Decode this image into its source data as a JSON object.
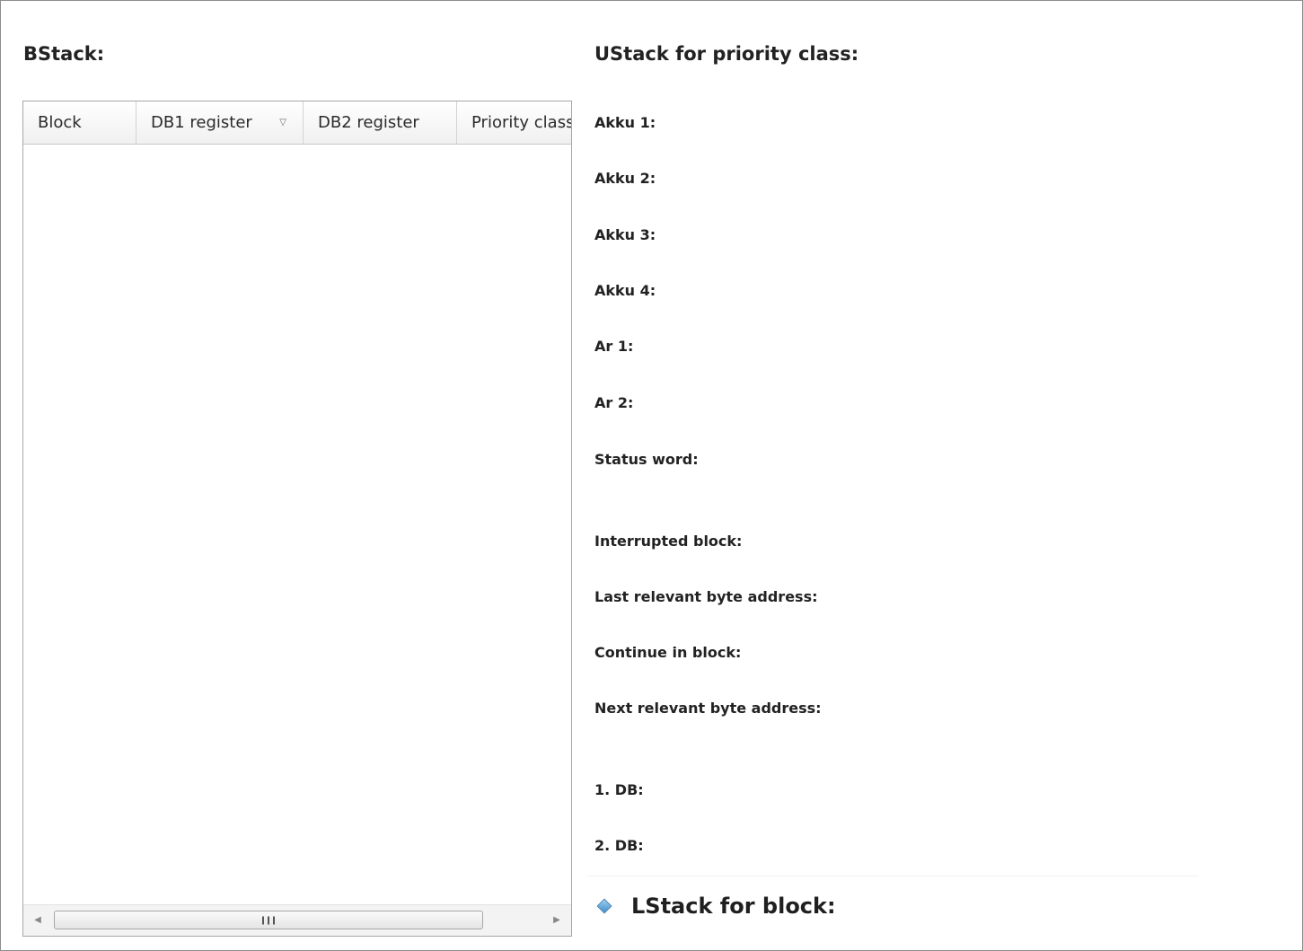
{
  "bstack": {
    "title": "BStack:",
    "columns": [
      "Block",
      "DB1 register",
      "DB2 register",
      "Priority class"
    ],
    "rows": []
  },
  "ustack": {
    "title": "UStack for priority class:",
    "fields": {
      "akku1": "Akku 1:",
      "akku2": "Akku 2:",
      "akku3": "Akku 3:",
      "akku4": "Akku 4:",
      "ar1": "Ar 1:",
      "ar2": "Ar 2:",
      "status_word": "Status word:",
      "interrupted_block": "Interrupted block:",
      "last_relevant_byte_address": "Last relevant byte address:",
      "continue_in_block": "Continue in block:",
      "next_relevant_byte_address": "Next relevant byte address:",
      "db1": "1. DB:",
      "db2": "2. DB:"
    }
  },
  "lstack": {
    "label": "LStack for block:",
    "expanded": false
  },
  "icons": {
    "sort": "sort-descending-icon",
    "scroll_left": "scroll-left-arrow-icon",
    "scroll_right": "scroll-right-arrow-icon",
    "expand": "expand-diamond-icon"
  },
  "colors": {
    "expand_icon": "#3f8ec9",
    "border": "#a6a6a6"
  }
}
